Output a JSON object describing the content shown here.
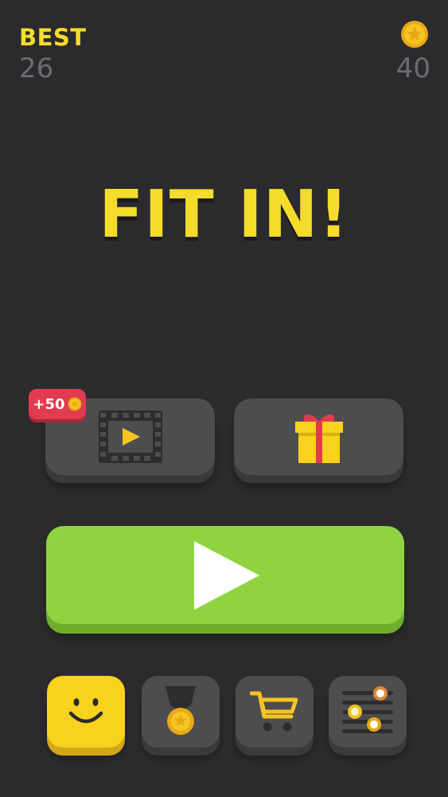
{
  "header": {
    "best_label": "BEST",
    "best_value": "26",
    "coins_value": "40",
    "coin_icon": "star-coin-icon"
  },
  "title": "FIT IN!",
  "buttons": {
    "video_reward": "+50",
    "video_icon": "film-play-icon",
    "gift_icon": "gift-icon",
    "play_icon": "play-icon",
    "character_icon": "smiley-face-icon",
    "achievements_icon": "medal-icon",
    "shop_icon": "shopping-cart-icon",
    "settings_icon": "sliders-icon"
  },
  "colors": {
    "background": "#2b2b2d",
    "accent_yellow": "#f5dc2c",
    "play_green": "#8fd440",
    "badge_red": "#e13b4f",
    "button_gray": "#4d4d50"
  }
}
